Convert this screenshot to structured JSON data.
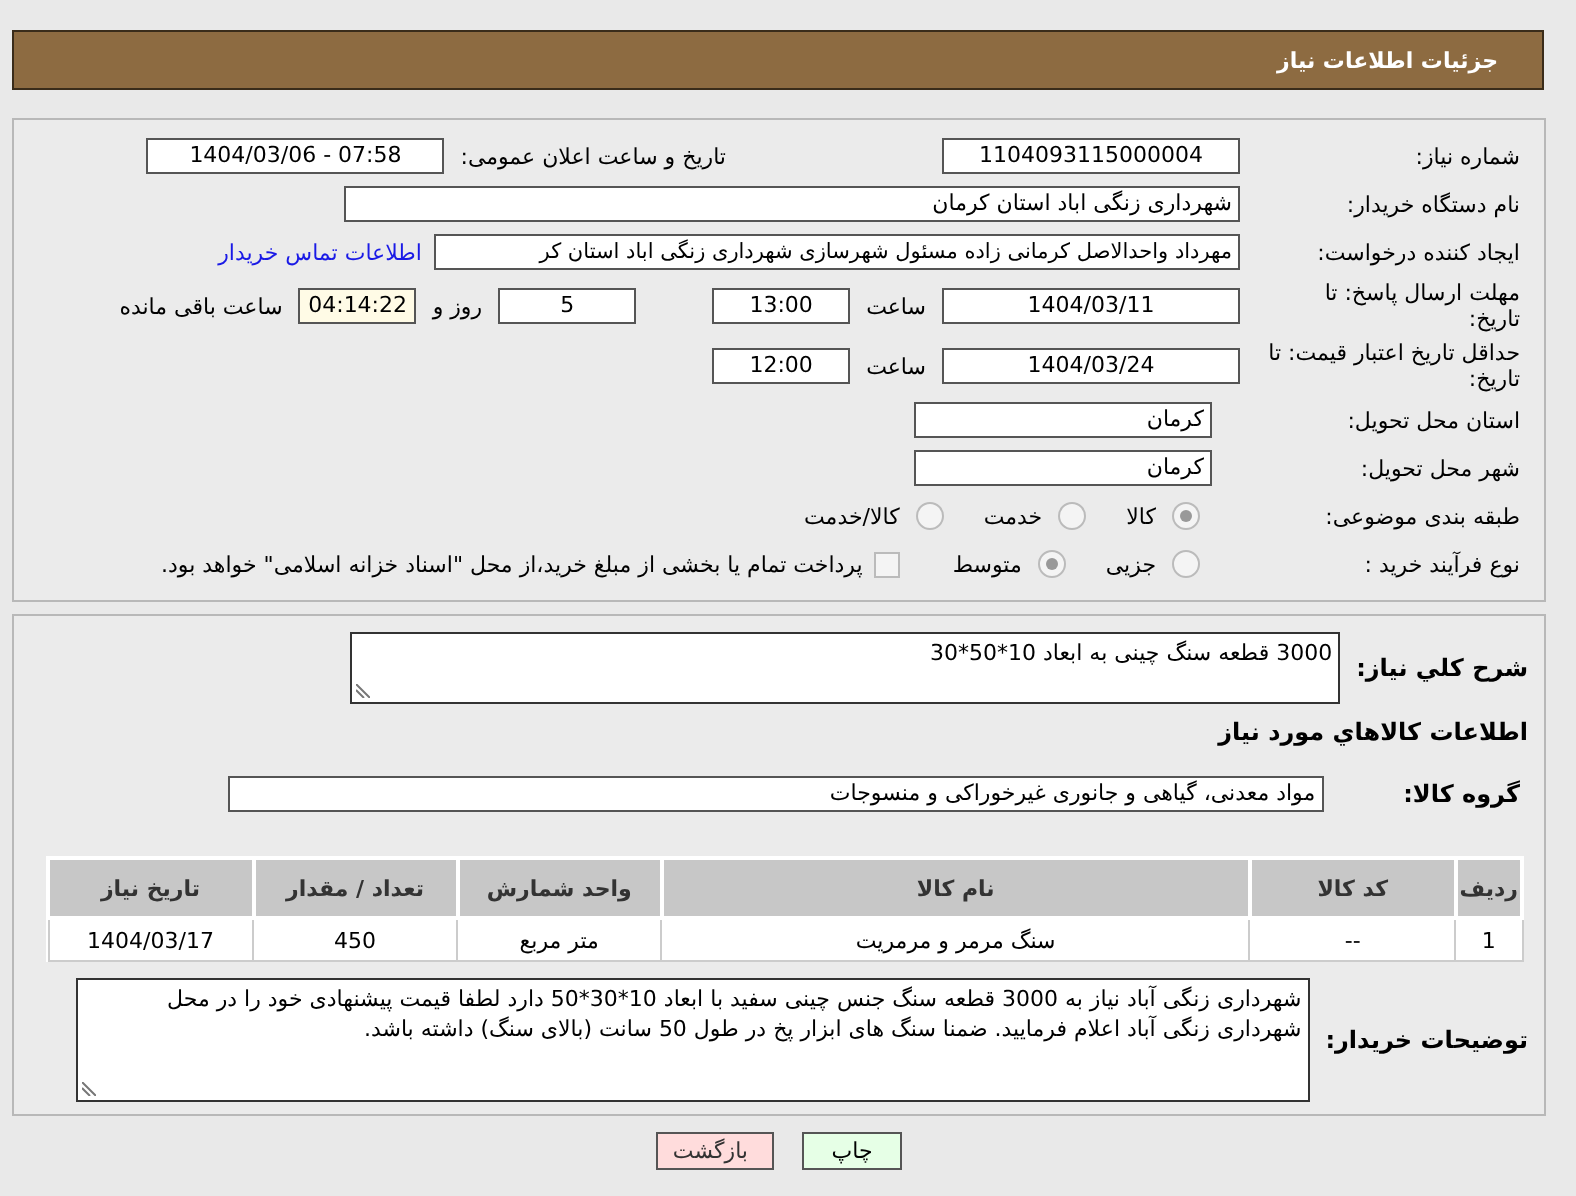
{
  "header": {
    "title": "جزئیات اطلاعات نیاز"
  },
  "need_number": {
    "label": "شماره نیاز:",
    "value": "1104093115000004"
  },
  "announce_datetime": {
    "label": "تاریخ و ساعت اعلان عمومی:",
    "value": "1404/03/06 - 07:58"
  },
  "buyer_org": {
    "label": "نام دستگاه خریدار:",
    "value": "شهرداری زنگی اباد استان کرمان"
  },
  "requester": {
    "label": "ایجاد کننده درخواست:",
    "value": "مهرداد واحدالاصل کرمانی زاده مسئول شهرسازی شهرداری زنگی اباد استان کر",
    "link": "اطلاعات تماس خریدار"
  },
  "response_deadline": {
    "label": "مهلت ارسال پاسخ: تا تاریخ:",
    "date": "1404/03/11",
    "time_label": "ساعت",
    "time": "13:00",
    "days": "5",
    "days_label": "روز و",
    "remaining": "04:14:22",
    "remaining_label": "ساعت باقی مانده"
  },
  "price_validity": {
    "label": "حداقل تاریخ اعتبار قیمت: تا تاریخ:",
    "date": "1404/03/24",
    "time_label": "ساعت",
    "time": "12:00"
  },
  "delivery_province": {
    "label": "استان محل تحویل:",
    "value": "کرمان"
  },
  "delivery_city": {
    "label": "شهر محل تحویل:",
    "value": "کرمان"
  },
  "category": {
    "label": "طبقه بندی موضوعی:",
    "options": [
      {
        "label": "کالا",
        "selected": true
      },
      {
        "label": "خدمت",
        "selected": false
      },
      {
        "label": "کالا/خدمت",
        "selected": false
      }
    ]
  },
  "process_type": {
    "label": "نوع فرآیند خرید :",
    "options": [
      {
        "label": "جزیی",
        "selected": false
      },
      {
        "label": "متوسط",
        "selected": true
      }
    ],
    "payment_note": {
      "label": "پرداخت تمام یا بخشی از مبلغ خرید،از محل \"اسناد خزانه اسلامی\" خواهد بود.",
      "checked": false
    }
  },
  "description": {
    "label": "شرح کلي نياز:",
    "value": "3000 قطعه سنگ چینی به ابعاد 10*50*30"
  },
  "goods_title": "اطلاعات کالاهاي مورد نياز",
  "goods_group": {
    "label": "گروه کالا:",
    "value": "مواد معدنی، گیاهی و جانوری غیرخوراکی و منسوجات"
  },
  "table": {
    "columns": [
      "ردیف",
      "کد کالا",
      "نام کالا",
      "واحد شمارش",
      "تعداد / مقدار",
      "تاریخ نیاز"
    ],
    "rows": [
      [
        "1",
        "--",
        "سنگ مرمر و مرمریت",
        "متر مربع",
        "450",
        "1404/03/17"
      ]
    ]
  },
  "buyer_notes": {
    "label": "توضیحات خریدار:",
    "value": "شهرداری زنگی آباد نیاز به 3000 قطعه سنگ جنس چینی سفید با ابعاد 10*30*50 دارد لطفا قیمت پیشنهادی خود را در محل شهرداری زنگی آباد اعلام فرمایید. ضمنا سنگ های ابزار پخ در طول 50 سانت (بالای سنگ) داشته باشد."
  },
  "buttons": [
    {
      "label": "چاپ",
      "kind": "print"
    },
    {
      "label": "بازگشت",
      "kind": "back"
    }
  ]
}
